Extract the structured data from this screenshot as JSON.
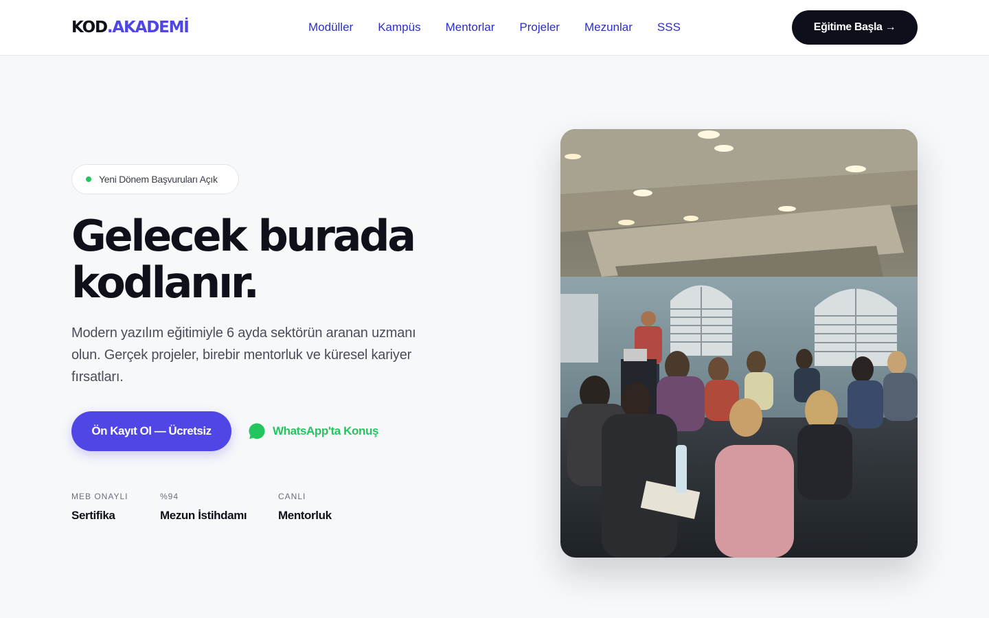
{
  "header": {
    "logo_part1": "KOD",
    "logo_part2": ".AKADEMİ",
    "nav": [
      "Modüller",
      "Kampüs",
      "Mentorlar",
      "Projeler",
      "Mezunlar",
      "SSS"
    ],
    "cta": "Eğitime Başla →"
  },
  "hero": {
    "badge": "Yeni Dönem Başvuruları Açık",
    "title_line1": "Gelecek burada",
    "title_line2": "kodlanır.",
    "subtitle": "Modern yazılım eğitimiyle 6 ayda sektörün aranan uzmanı olun. Gerçek projeler, birebir mentorluk ve küresel kariyer fırsatları.",
    "primary_button": "Ön Kayıt Ol — Ücretsiz",
    "whatsapp_link": "WhatsApp'ta Konuş",
    "stats": [
      {
        "label": "MEB ONAYLI",
        "value": "Sertifika"
      },
      {
        "label": "%94",
        "value": "Mezun İstihdamı"
      },
      {
        "label": "CANLI",
        "value": "Mentorluk"
      }
    ]
  },
  "colors": {
    "accent": "#4f46e5",
    "dark": "#0d0f1a",
    "whatsapp": "#22c55e",
    "background": "#f7f8fa"
  },
  "icons": {
    "whatsapp": "whatsapp-icon",
    "status_dot": "status-dot-icon"
  }
}
